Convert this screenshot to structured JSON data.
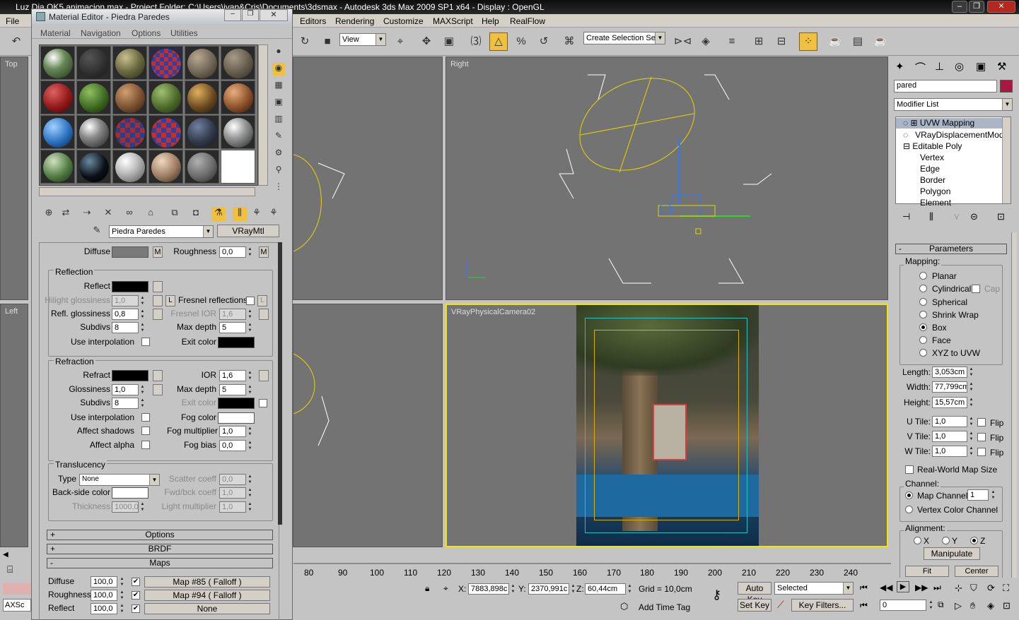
{
  "titlebar": {
    "text": "Luz Dia OK5 animacion.max - Project Folder: C:\\Users\\ivan&Cris\\Documents\\3dsmax     - Autodesk 3ds Max  2009 SP1  x64      - Display : OpenGL"
  },
  "menubar": {
    "items": [
      "File",
      "Editors",
      "Rendering",
      "Customize",
      "MAXScript",
      "Help",
      "RealFlow"
    ]
  },
  "toolbar": {
    "view_dropdown": "View",
    "selection_set_placeholder": "Create Selection Set"
  },
  "viewports": {
    "top": "Top",
    "right": "Right",
    "left": "Left",
    "camera": "VRayPhysicalCamera02"
  },
  "material_editor": {
    "title": "Material Editor - Piedra Paredes",
    "menu": [
      "Material",
      "Navigation",
      "Options",
      "Utilities"
    ],
    "material_name": "Piedra Paredes",
    "material_type": "VRayMtl",
    "diffuse": {
      "label": "Diffuse",
      "map_btn": "M",
      "roughness_label": "Roughness",
      "roughness": "0,0",
      "rough_btn": "M"
    },
    "reflection": {
      "group": "Reflection",
      "reflect": "Reflect",
      "hilight_gloss_label": "Hilight glossiness",
      "hilight_gloss": "1,0",
      "l_btn": "L",
      "fresnel": "Fresnel reflections",
      "fresnel_l": "L",
      "refl_gloss_label": "Refl. glossiness",
      "refl_gloss": "0,8",
      "fresnel_ior_label": "Fresnel IOR",
      "fresnel_ior": "1,6",
      "subdivs_label": "Subdivs",
      "subdivs": "8",
      "max_depth_label": "Max depth",
      "max_depth": "5",
      "use_interp": "Use interpolation",
      "exit_color": "Exit color"
    },
    "refraction": {
      "group": "Refraction",
      "refract": "Refract",
      "ior_label": "IOR",
      "ior": "1,6",
      "gloss_label": "Glossiness",
      "gloss": "1,0",
      "max_depth_label": "Max depth",
      "max_depth": "5",
      "subdivs_label": "Subdivs",
      "subdivs": "8",
      "exit_color": "Exit color",
      "use_interp": "Use interpolation",
      "fog_color": "Fog color",
      "affect_shadows": "Affect shadows",
      "fog_mult_label": "Fog multiplier",
      "fog_mult": "1,0",
      "affect_alpha": "Affect alpha",
      "fog_bias_label": "Fog bias",
      "fog_bias": "0,0"
    },
    "translucency": {
      "group": "Translucency",
      "type_label": "Type",
      "type": "None",
      "scatter_label": "Scatter coeff",
      "scatter": "0,0",
      "backside_label": "Back-side color",
      "fwdbck_label": "Fwd/bck coeff",
      "fwdbck": "1,0",
      "thickness_label": "Thickness",
      "thickness": "1000,0",
      "light_mult_label": "Light multiplier",
      "light_mult": "1,0"
    },
    "rollouts": {
      "options": "Options",
      "brdf": "BRDF",
      "maps": "Maps",
      "plus": "+",
      "minus": "-"
    },
    "maps": [
      {
        "label": "Diffuse",
        "amount": "100,0",
        "map": "Map #85  ( Falloff )"
      },
      {
        "label": "Roughness",
        "amount": "100,0",
        "map": "Map #94  ( Falloff )"
      },
      {
        "label": "Reflect",
        "amount": "100,0",
        "map": "None"
      }
    ],
    "check": "✔"
  },
  "command_panel": {
    "object_name": "pared",
    "modifier_list": "Modifier List",
    "stack": [
      "UVW Mapping",
      "VRayDisplacementMod",
      "Editable Poly",
      "Vertex",
      "Edge",
      "Border",
      "Polygon",
      "Element"
    ],
    "parameters_title": "Parameters",
    "minus": "-",
    "mapping_group": "Mapping:",
    "mapping": [
      "Planar",
      "Cylindrical",
      "Spherical",
      "Shrink Wrap",
      "Box",
      "Face",
      "XYZ to UVW"
    ],
    "cap": "Cap",
    "length_label": "Length:",
    "length": "3,053cm",
    "width_label": "Width:",
    "width": "77,799cm",
    "height_label": "Height:",
    "height": "15,57cm",
    "utile_label": "U Tile:",
    "utile": "1,0",
    "vtile_label": "V Tile:",
    "vtile": "1,0",
    "wtile_label": "W Tile:",
    "wtile": "1,0",
    "flip": "Flip",
    "realworld": "Real-World Map Size",
    "channel_group": "Channel:",
    "map_channel_label": "Map Channel:",
    "map_channel": "1",
    "vertex_color": "Vertex Color Channel",
    "alignment_group": "Alignment:",
    "axes": [
      "X",
      "Y",
      "Z"
    ],
    "manipulate": "Manipulate",
    "fit": "Fit",
    "center": "Center"
  },
  "ruler": [
    "80",
    "90",
    "100",
    "110",
    "120",
    "130",
    "140",
    "150",
    "160",
    "170",
    "180",
    "190",
    "200",
    "210",
    "220",
    "230",
    "240"
  ],
  "status": {
    "x_label": "X:",
    "x": "7883,898c",
    "y_label": "Y:",
    "y": "2370,991c",
    "z_label": "Z:",
    "z": "60,44cm",
    "grid": "Grid = 10,0cm",
    "auto_key": "Auto Key",
    "selected": "Selected",
    "set_key": "Set Key",
    "key_filters": "Key Filters...",
    "frame": "0",
    "add_time_tag": "Add Time Tag",
    "maxscript": "AXSc"
  }
}
